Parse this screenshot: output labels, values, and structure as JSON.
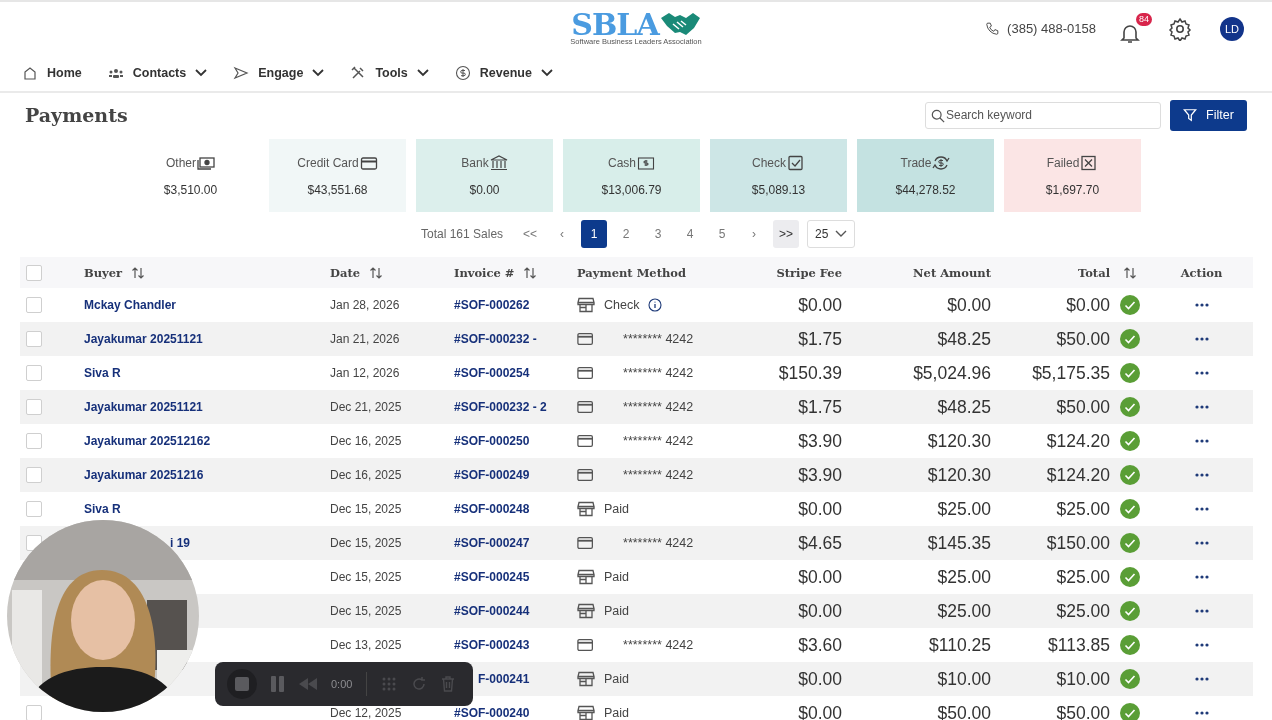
{
  "header": {
    "logo": {
      "mark": "SBLA",
      "tagline": "Software Business Leaders Association"
    },
    "phone": "(385) 488-0158",
    "notifications": "84",
    "avatar": "LD"
  },
  "nav": [
    {
      "label": "Home",
      "kind": "home",
      "dropdown": false
    },
    {
      "label": "Contacts",
      "kind": "contacts",
      "dropdown": true
    },
    {
      "label": "Engage",
      "kind": "send",
      "dropdown": true
    },
    {
      "label": "Tools",
      "kind": "tools",
      "dropdown": true
    },
    {
      "label": "Revenue",
      "kind": "dollar",
      "dropdown": true
    }
  ],
  "page": {
    "title": "Payments",
    "search": {
      "placeholder": "Search keyword"
    },
    "filter_button": "Filter"
  },
  "cards": [
    {
      "label": "Other",
      "kind": "cash",
      "amount": "$3,510.00",
      "color": "#ffffff"
    },
    {
      "label": "Credit Card",
      "kind": "card",
      "amount": "$43,551.68",
      "color": "#f1f7f7"
    },
    {
      "label": "Bank",
      "kind": "bank",
      "amount": "$0.00",
      "color": "#dcefec"
    },
    {
      "label": "Cash",
      "kind": "bill",
      "amount": "$13,006.79",
      "color": "#d8eeea"
    },
    {
      "label": "Check",
      "kind": "check",
      "amount": "$5,089.13",
      "color": "#cde6e6"
    },
    {
      "label": "Trade",
      "kind": "trade",
      "amount": "$44,278.52",
      "color": "#c4e2e1"
    },
    {
      "label": "Failed",
      "kind": "failed",
      "amount": "$1,697.70",
      "color": "#fbe5e5"
    }
  ],
  "pagination": {
    "total": "Total 161 Sales",
    "first": "<<",
    "prev": "‹",
    "pages": [
      {
        "label": "1",
        "selected": true
      },
      {
        "label": "2",
        "selected": false
      },
      {
        "label": "3",
        "selected": false
      },
      {
        "label": "4",
        "selected": false
      },
      {
        "label": "5",
        "selected": false
      }
    ],
    "next": "›",
    "last": ">>",
    "page_size": "25"
  },
  "table": {
    "columns": [
      "Buyer",
      "Date",
      "Invoice #",
      "Payment Method",
      "Stripe Fee",
      "Net Amount",
      "Total",
      "Action"
    ],
    "select_all_checked": false,
    "rows": [
      {
        "checked": false,
        "buyer": "Mckay Chandler",
        "date": "Jan 28, 2026",
        "invoice": "#SOF-000262",
        "kind": "store",
        "method": "Check",
        "info": true,
        "fee": "$0.00",
        "net": "$0.00",
        "total": "$0.00",
        "paid": true
      },
      {
        "checked": false,
        "buyer": "Jayakumar 20251121",
        "date": "Jan 21, 2026",
        "invoice": "#SOF-000232 -",
        "kind": "card",
        "method": "******** 4242",
        "info": false,
        "fee": "$1.75",
        "net": "$48.25",
        "total": "$50.00",
        "paid": true
      },
      {
        "checked": false,
        "buyer": "Siva R",
        "date": "Jan 12, 2026",
        "invoice": "#SOF-000254",
        "kind": "card",
        "method": "******** 4242",
        "info": false,
        "fee": "$150.39",
        "net": "$5,024.96",
        "total": "$5,175.35",
        "paid": true
      },
      {
        "checked": false,
        "buyer": "Jayakumar 20251121",
        "date": "Dec 21, 2025",
        "invoice": "#SOF-000232 - 2",
        "kind": "card",
        "method": "******** 4242",
        "info": false,
        "fee": "$1.75",
        "net": "$48.25",
        "total": "$50.00",
        "paid": true
      },
      {
        "checked": false,
        "buyer": "Jayakumar 202512162",
        "date": "Dec 16, 2025",
        "invoice": "#SOF-000250",
        "kind": "card",
        "method": "******** 4242",
        "info": false,
        "fee": "$3.90",
        "net": "$120.30",
        "total": "$124.20",
        "paid": true
      },
      {
        "checked": false,
        "buyer": "Jayakumar 20251216",
        "date": "Dec 16, 2025",
        "invoice": "#SOF-000249",
        "kind": "card",
        "method": "******** 4242",
        "info": false,
        "fee": "$3.90",
        "net": "$120.30",
        "total": "$124.20",
        "paid": true
      },
      {
        "checked": false,
        "buyer": "Siva R",
        "date": "Dec 15, 2025",
        "invoice": "#SOF-000248",
        "kind": "store",
        "method": "Paid",
        "info": false,
        "fee": "$0.00",
        "net": "$25.00",
        "total": "$25.00",
        "paid": true
      },
      {
        "checked": false,
        "buyer_tail": "i 19",
        "date": "Dec 15, 2025",
        "invoice": "#SOF-000247",
        "kind": "card",
        "method": "******** 4242",
        "info": false,
        "fee": "$4.65",
        "net": "$145.35",
        "total": "$150.00",
        "paid": true
      },
      {
        "date": "Dec 15, 2025",
        "invoice": "#SOF-000245",
        "kind": "store",
        "method": "Paid",
        "info": false,
        "fee": "$0.00",
        "net": "$25.00",
        "total": "$25.00",
        "paid": true
      },
      {
        "date": "Dec 15, 2025",
        "invoice": "#SOF-000244",
        "kind": "store",
        "method": "Paid",
        "info": false,
        "fee": "$0.00",
        "net": "$25.00",
        "total": "$25.00",
        "paid": true
      },
      {
        "date": "Dec 13, 2025",
        "invoice": "#SOF-000243",
        "kind": "card",
        "method": "******** 4242",
        "info": false,
        "fee": "$3.60",
        "net": "$110.25",
        "total": "$113.85",
        "paid": true
      },
      {
        "invoice_tail": "F-000241",
        "kind": "store",
        "method": "Paid",
        "info": false,
        "fee": "$0.00",
        "net": "$10.00",
        "total": "$10.00",
        "paid": true
      },
      {
        "checked": false,
        "date": "Dec 12, 2025",
        "invoice": "#SOF-000240",
        "kind": "store",
        "method": "Paid",
        "info": false,
        "fee": "$0.00",
        "net": "$50.00",
        "total": "$50.00",
        "paid": true
      }
    ]
  },
  "recorder": {
    "time": "0:00"
  }
}
